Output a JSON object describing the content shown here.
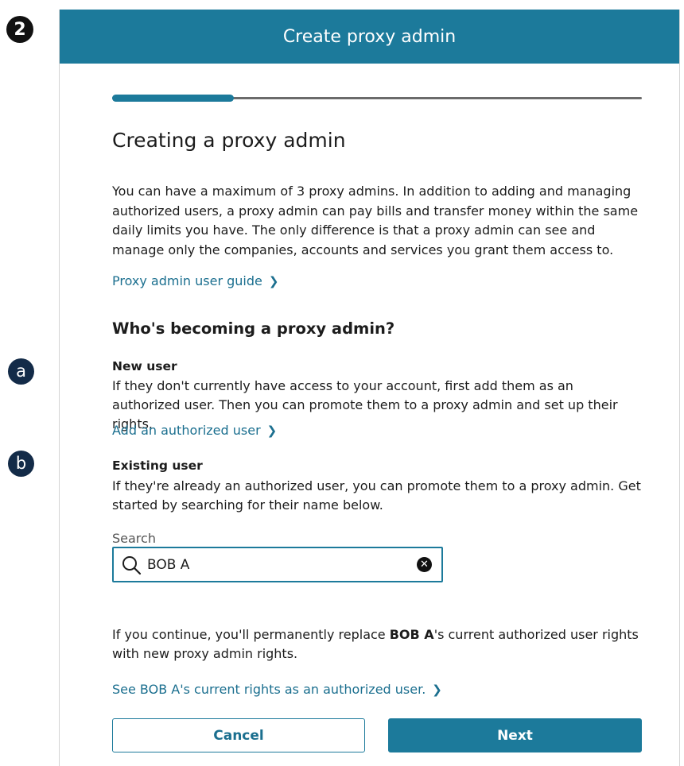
{
  "annotations": {
    "step_badge": "2",
    "badge_a": "a",
    "badge_b": "b"
  },
  "dialog": {
    "title": "Create proxy admin",
    "progress_percent": 23,
    "heading": "Creating a proxy admin",
    "intro": "You can have a maximum of 3 proxy admins. In addition to adding and managing authorized users, a proxy admin can pay bills and transfer money within the same daily limits you have. The only difference is that a proxy admin can see and manage only the companies, accounts and services you grant them access to.",
    "guide_link": "Proxy admin user guide",
    "who_heading": "Who's becoming a proxy admin?",
    "new_user": {
      "label": "New user",
      "description": "If they don't currently have access to your account, first add them as an authorized user. Then you can promote them to a proxy admin and set up their rights.",
      "link": "Add an authorized user"
    },
    "existing_user": {
      "label": "Existing user",
      "description": "If they're already an authorized user, you can promote them to a proxy admin. Get started by searching for their name below."
    },
    "search": {
      "label": "Search",
      "value": "BOB A"
    },
    "warning": {
      "prefix": "If you continue, you'll permanently replace ",
      "name": "BOB A",
      "suffix": "'s current authorized user rights with new proxy admin rights."
    },
    "rights_link": "See BOB A's current rights as an authorized user.",
    "buttons": {
      "cancel": "Cancel",
      "next": "Next"
    }
  },
  "colors": {
    "header_bg": "#1c7a9b",
    "link": "#1b6f8f",
    "badge_dark": "#132b48"
  }
}
